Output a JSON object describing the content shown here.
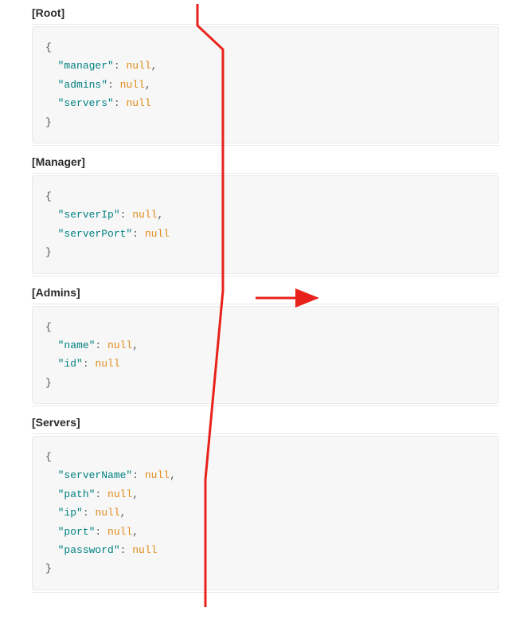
{
  "sections": [
    {
      "title": "[Root]",
      "lines": [
        {
          "type": "brace",
          "text": "{"
        },
        {
          "type": "kv",
          "key": "manager",
          "value": "null",
          "comma": true
        },
        {
          "type": "kv",
          "key": "admins",
          "value": "null",
          "comma": true
        },
        {
          "type": "kv",
          "key": "servers",
          "value": "null",
          "comma": false
        },
        {
          "type": "brace",
          "text": "}"
        }
      ]
    },
    {
      "title": "[Manager]",
      "lines": [
        {
          "type": "brace",
          "text": "{"
        },
        {
          "type": "kv",
          "key": "serverIp",
          "value": "null",
          "comma": true
        },
        {
          "type": "kv",
          "key": "serverPort",
          "value": "null",
          "comma": false
        },
        {
          "type": "brace",
          "text": "}"
        }
      ]
    },
    {
      "title": "[Admins]",
      "lines": [
        {
          "type": "brace",
          "text": "{"
        },
        {
          "type": "kv",
          "key": "name",
          "value": "null",
          "comma": true
        },
        {
          "type": "kv",
          "key": "id",
          "value": "null",
          "comma": false
        },
        {
          "type": "brace",
          "text": "}"
        }
      ]
    },
    {
      "title": "[Servers]",
      "lines": [
        {
          "type": "brace",
          "text": "{"
        },
        {
          "type": "kv",
          "key": "serverName",
          "value": "null",
          "comma": true
        },
        {
          "type": "kv",
          "key": "path",
          "value": "null",
          "comma": true
        },
        {
          "type": "kv",
          "key": "ip",
          "value": "null",
          "comma": true
        },
        {
          "type": "kv",
          "key": "port",
          "value": "null",
          "comma": true
        },
        {
          "type": "kv",
          "key": "password",
          "value": "null",
          "comma": false
        },
        {
          "type": "brace",
          "text": "}"
        }
      ]
    }
  ],
  "annotation": {
    "color": "#e8221b"
  }
}
